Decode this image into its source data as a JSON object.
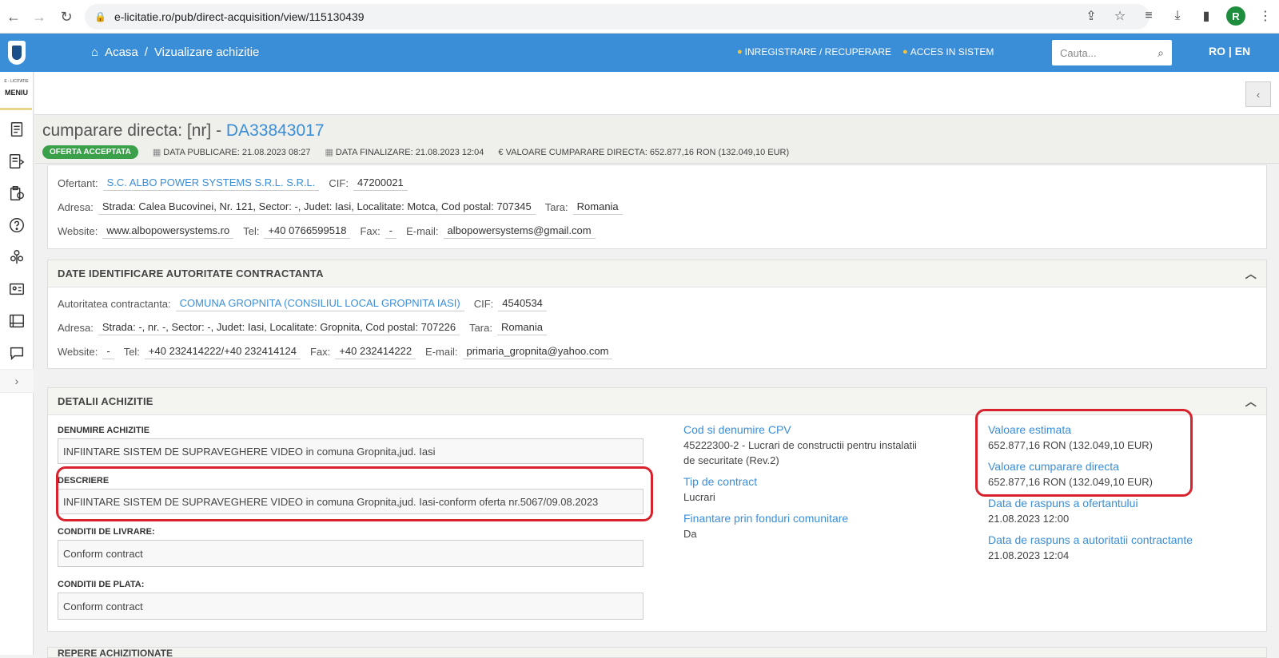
{
  "browser": {
    "url": "e-licitatie.ro/pub/direct-acquisition/view/115130439",
    "profile_initial": "R"
  },
  "topbar": {
    "breadcrumb_home": "Acasa",
    "breadcrumb_sep": "/",
    "breadcrumb_current": "Vizualizare achizitie",
    "register_link": "INREGISTRARE / RECUPERARE",
    "login_link": "ACCES IN SISTEM",
    "search_placeholder": "Cauta...",
    "lang_ro": "RO",
    "lang_sep": "|",
    "lang_en": "EN"
  },
  "sidebar": {
    "brand": "E - LICITATIE",
    "menu_label": "MENIU",
    "expand_arrow": "›",
    "icons": [
      "document-icon",
      "list-export-icon",
      "clipboard-icon",
      "help-icon",
      "tree-icon",
      "contact-card-icon",
      "catalog-icon",
      "chat-icon"
    ]
  },
  "header": {
    "title_prefix": "cumparare directa: [nr] - ",
    "title_code": "DA33843017",
    "status_badge": "OFERTA ACCEPTATA",
    "published": "DATA PUBLICARE: 21.08.2023 08:27",
    "finalized": "DATA FINALIZARE: 21.08.2023 12:04",
    "value": "€ VALOARE CUMPARARE DIRECTA: 652.877,16  RON (132.049,10  EUR)"
  },
  "ofertant": {
    "label_ofertant": "Ofertant:",
    "name": "S.C. ALBO POWER SYSTEMS S.R.L. S.R.L.",
    "label_cif": "CIF:",
    "cif": "47200021",
    "label_adresa": "Adresa:",
    "adresa": "Strada: Calea Bucovinei, Nr. 121, Sector: -, Judet: Iasi, Localitate: Motca, Cod postal: 707345",
    "label_tara": "Tara:",
    "tara": "Romania",
    "label_website": "Website:",
    "website": "www.albopowersystems.ro",
    "label_tel": "Tel:",
    "tel": "+40 0766599518",
    "label_fax": "Fax:",
    "fax": "-",
    "label_email": "E-mail:",
    "email": "albopowersystems@gmail.com"
  },
  "autoritate": {
    "heading": "DATE IDENTIFICARE AUTORITATE CONTRACTANTA",
    "label_autoritate": "Autoritatea contractanta:",
    "name": "COMUNA GROPNITA (CONSILIUL LOCAL GROPNITA IASI)",
    "label_cif": "CIF:",
    "cif": "4540534",
    "label_adresa": "Adresa:",
    "adresa": "Strada: -, nr. -, Sector: -, Judet: Iasi, Localitate: Gropnita, Cod postal: 707226",
    "label_tara": "Tara:",
    "tara": "Romania",
    "label_website": "Website:",
    "website": "-",
    "label_tel": "Tel:",
    "tel": "+40 232414222/+40 232414124",
    "label_fax": "Fax:",
    "fax": "+40 232414222",
    "label_email": "E-mail:",
    "email": "primaria_gropnita@yahoo.com"
  },
  "detalii": {
    "heading": "DETALII ACHIZITIE",
    "denumire_label": "DENUMIRE ACHIZITIE",
    "denumire": "INFIINTARE SISTEM DE SUPRAVEGHERE VIDEO in comuna Gropnita,jud. Iasi",
    "descriere_label": "DESCRIERE",
    "descriere": "INFIINTARE SISTEM DE SUPRAVEGHERE VIDEO in comuna Gropnita,jud. Iasi-conform oferta nr.5067/09.08.2023",
    "livrare_label": "CONDITII DE LIVRARE:",
    "livrare": "Conform contract",
    "plata_label": "CONDITII DE PLATA:",
    "plata": "Conform contract",
    "cpv_title": "Cod si denumire CPV",
    "cpv_line1": "45222300-2 - Lucrari de constructii pentru instalatii",
    "cpv_line2": "de securitate (Rev.2)",
    "tip_title": "Tip de contract",
    "tip": "Lucrari",
    "fonduri_title": "Finantare prin fonduri comunitare",
    "fonduri": "Da",
    "estimata_title": "Valoare estimata",
    "estimata": "652.877,16  RON (132.049,10  EUR)",
    "cumparare_title": "Valoare cumparare directa",
    "cumparare": "652.877,16  RON (132.049,10  EUR)",
    "raspuns_ofertant_title": "Data de raspuns a ofertantului",
    "raspuns_ofertant": "21.08.2023 12:00",
    "raspuns_autoritate_title": "Data de raspuns a autoritatii contractante",
    "raspuns_autoritate": "21.08.2023 12:04"
  },
  "next_panel": {
    "heading": "REPERE ACHIZITIONATE"
  },
  "colors": {
    "brand_blue": "#3a8ed8",
    "badge_green": "#3aa04a",
    "highlight_red": "#d8222d"
  }
}
